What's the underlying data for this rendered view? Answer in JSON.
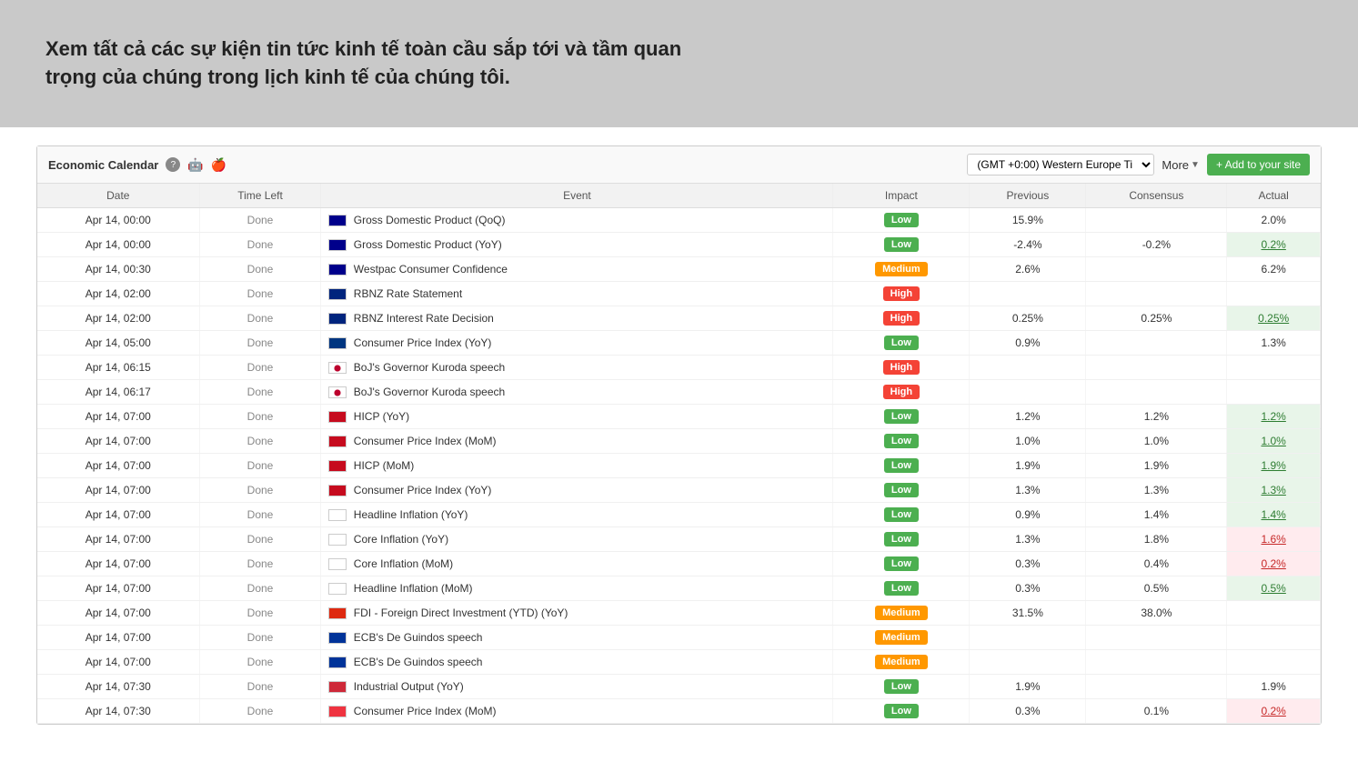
{
  "hero": {
    "text": "Xem tất cả các sự kiện tin tức kinh tế toàn cầu sắp tới và tầm quan trọng của chúng trong lịch kinh tế của chúng tôi."
  },
  "widget": {
    "title": "Economic Calendar",
    "timezone": "(GMT +0:00) Western Europe Ti",
    "more_label": "More",
    "add_label": "+ Add to your site"
  },
  "table": {
    "headers": [
      "Date",
      "Time Left",
      "Event",
      "Impact",
      "Previous",
      "Consensus",
      "Actual"
    ],
    "rows": [
      {
        "date": "Apr 14, 00:00",
        "time_left": "Done",
        "flag": "au",
        "event": "Gross Domestic Product (QoQ)",
        "impact": "Low",
        "previous": "15.9%",
        "consensus": "",
        "actual": "2.0%",
        "actual_style": "plain"
      },
      {
        "date": "Apr 14, 00:00",
        "time_left": "Done",
        "flag": "au",
        "event": "Gross Domestic Product (YoY)",
        "impact": "Low",
        "previous": "-2.4%",
        "consensus": "-0.2%",
        "actual": "0.2%",
        "actual_style": "green"
      },
      {
        "date": "Apr 14, 00:30",
        "time_left": "Done",
        "flag": "au",
        "event": "Westpac Consumer Confidence",
        "impact": "Medium",
        "previous": "2.6%",
        "consensus": "",
        "actual": "6.2%",
        "actual_style": "plain"
      },
      {
        "date": "Apr 14, 02:00",
        "time_left": "Done",
        "flag": "nz",
        "event": "RBNZ Rate Statement",
        "impact": "High",
        "previous": "",
        "consensus": "",
        "actual": "",
        "actual_style": "plain"
      },
      {
        "date": "Apr 14, 02:00",
        "time_left": "Done",
        "flag": "nz",
        "event": "RBNZ Interest Rate Decision",
        "impact": "High",
        "previous": "0.25%",
        "consensus": "0.25%",
        "actual": "0.25%",
        "actual_style": "green"
      },
      {
        "date": "Apr 14, 05:00",
        "time_left": "Done",
        "flag": "fi",
        "event": "Consumer Price Index (YoY)",
        "impact": "Low",
        "previous": "0.9%",
        "consensus": "",
        "actual": "1.3%",
        "actual_style": "plain"
      },
      {
        "date": "Apr 14, 06:15",
        "time_left": "Done",
        "flag": "jp",
        "event": "BoJ's Governor Kuroda speech",
        "impact": "High",
        "previous": "",
        "consensus": "",
        "actual": "",
        "actual_style": "plain"
      },
      {
        "date": "Apr 14, 06:17",
        "time_left": "Done",
        "flag": "jp",
        "event": "BoJ's Governor Kuroda speech",
        "impact": "High",
        "previous": "",
        "consensus": "",
        "actual": "",
        "actual_style": "plain"
      },
      {
        "date": "Apr 14, 07:00",
        "time_left": "Done",
        "flag": "es",
        "event": "HICP (YoY)",
        "impact": "Low",
        "previous": "1.2%",
        "consensus": "1.2%",
        "actual": "1.2%",
        "actual_style": "green"
      },
      {
        "date": "Apr 14, 07:00",
        "time_left": "Done",
        "flag": "es",
        "event": "Consumer Price Index (MoM)",
        "impact": "Low",
        "previous": "1.0%",
        "consensus": "1.0%",
        "actual": "1.0%",
        "actual_style": "green"
      },
      {
        "date": "Apr 14, 07:00",
        "time_left": "Done",
        "flag": "es",
        "event": "HICP (MoM)",
        "impact": "Low",
        "previous": "1.9%",
        "consensus": "1.9%",
        "actual": "1.9%",
        "actual_style": "green"
      },
      {
        "date": "Apr 14, 07:00",
        "time_left": "Done",
        "flag": "es",
        "event": "Consumer Price Index (YoY)",
        "impact": "Low",
        "previous": "1.3%",
        "consensus": "1.3%",
        "actual": "1.3%",
        "actual_style": "green"
      },
      {
        "date": "Apr 14, 07:00",
        "time_left": "Done",
        "flag": "kr",
        "event": "Headline Inflation (YoY)",
        "impact": "Low",
        "previous": "0.9%",
        "consensus": "1.4%",
        "actual": "1.4%",
        "actual_style": "green"
      },
      {
        "date": "Apr 14, 07:00",
        "time_left": "Done",
        "flag": "kr",
        "event": "Core Inflation (YoY)",
        "impact": "Low",
        "previous": "1.3%",
        "consensus": "1.8%",
        "actual": "1.6%",
        "actual_style": "red"
      },
      {
        "date": "Apr 14, 07:00",
        "time_left": "Done",
        "flag": "kr",
        "event": "Core Inflation (MoM)",
        "impact": "Low",
        "previous": "0.3%",
        "consensus": "0.4%",
        "actual": "0.2%",
        "actual_style": "red"
      },
      {
        "date": "Apr 14, 07:00",
        "time_left": "Done",
        "flag": "kr",
        "event": "Headline Inflation (MoM)",
        "impact": "Low",
        "previous": "0.3%",
        "consensus": "0.5%",
        "actual": "0.5%",
        "actual_style": "green"
      },
      {
        "date": "Apr 14, 07:00",
        "time_left": "Done",
        "flag": "cn",
        "event": "FDI - Foreign Direct Investment (YTD) (YoY)",
        "impact": "Medium",
        "previous": "31.5%",
        "consensus": "38.0%",
        "actual": "",
        "actual_style": "plain"
      },
      {
        "date": "Apr 14, 07:00",
        "time_left": "Done",
        "flag": "eu",
        "event": "ECB's De Guindos speech",
        "impact": "Medium",
        "previous": "",
        "consensus": "",
        "actual": "",
        "actual_style": "plain"
      },
      {
        "date": "Apr 14, 07:00",
        "time_left": "Done",
        "flag": "eu",
        "event": "ECB's De Guindos speech",
        "impact": "Medium",
        "previous": "",
        "consensus": "",
        "actual": "",
        "actual_style": "plain"
      },
      {
        "date": "Apr 14, 07:30",
        "time_left": "Done",
        "flag": "hu",
        "event": "Industrial Output (YoY)",
        "impact": "Low",
        "previous": "1.9%",
        "consensus": "",
        "actual": "1.9%",
        "actual_style": "plain"
      },
      {
        "date": "Apr 14, 07:30",
        "time_left": "Done",
        "flag": "sg",
        "event": "Consumer Price Index (MoM)",
        "impact": "Low",
        "previous": "0.3%",
        "consensus": "0.1%",
        "actual": "0.2%",
        "actual_style": "red"
      }
    ]
  }
}
